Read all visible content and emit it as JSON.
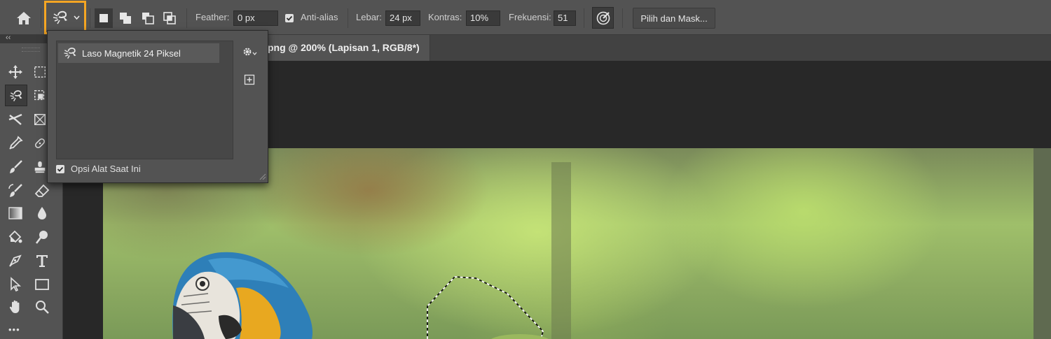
{
  "options_bar": {
    "tool_icon": "magnetic-lasso-icon",
    "highlight_color": "#f5a623",
    "feather_label": "Feather:",
    "feather_value": "0 px",
    "antialias_label": "Anti-alias",
    "antialias_checked": true,
    "width_label": "Lebar:",
    "width_value": "24 px",
    "contrast_label": "Kontras:",
    "contrast_value": "10%",
    "frequency_label": "Frekuensi:",
    "frequency_value": "51",
    "select_mask_label": "Pilih dan Mask..."
  },
  "document_tab": {
    "title": "png @ 200% (Lapisan 1, RGB/8*)"
  },
  "tool_preset_panel": {
    "preset_name": "Laso Magnetik 24 Piksel",
    "current_tool_only_label": "Opsi Alat Saat Ini",
    "current_tool_only_checked": true
  },
  "toolbar": {
    "collapse_glyph": "‹‹",
    "more_glyph": "•••"
  }
}
